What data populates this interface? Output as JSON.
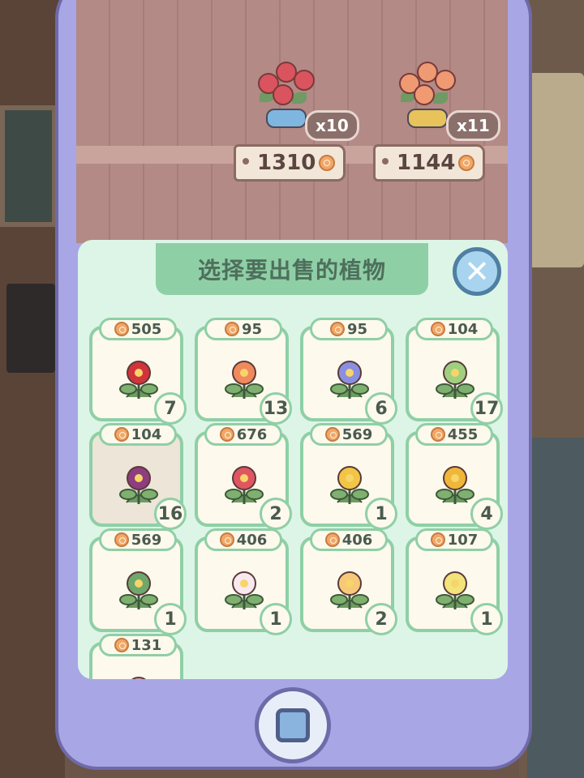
{
  "shelf": {
    "bouquets": [
      {
        "quantity": "x10",
        "price": "1310",
        "bow_color": "#7fb6e0",
        "flower_color": "#d9545e"
      },
      {
        "quantity": "x11",
        "price": "1144",
        "bow_color": "#e8c25a",
        "flower_color": "#ef9a72"
      }
    ]
  },
  "dialog": {
    "title": "选择要出售的植物",
    "close_icon": "close-icon",
    "plants": [
      {
        "price": "505",
        "count": "7",
        "icon": "red-flower-lilypad-icon",
        "color": "#d2343b"
      },
      {
        "price": "95",
        "count": "13",
        "icon": "orange-lily-icon",
        "color": "#f08a5c"
      },
      {
        "price": "95",
        "count": "6",
        "icon": "blue-iris-icon",
        "color": "#8b8fe0"
      },
      {
        "price": "104",
        "count": "17",
        "icon": "green-rose-icon",
        "color": "#9fd07f"
      },
      {
        "price": "104",
        "count": "16",
        "icon": "purple-peony-icon",
        "color": "#8e3d7e"
      },
      {
        "price": "676",
        "count": "2",
        "icon": "red-tulip-icon",
        "color": "#e05660"
      },
      {
        "price": "569",
        "count": "1",
        "icon": "yellow-daffodil-icon",
        "color": "#f3c544"
      },
      {
        "price": "455",
        "count": "4",
        "icon": "yellow-daffodil-icon",
        "color": "#f0b638"
      },
      {
        "price": "569",
        "count": "1",
        "icon": "caladium-leaf-icon",
        "color": "#6fa86a"
      },
      {
        "price": "406",
        "count": "1",
        "icon": "white-lotus-icon",
        "color": "#f7e9ef"
      },
      {
        "price": "406",
        "count": "2",
        "icon": "yellow-lotus-icon",
        "color": "#f6c878"
      },
      {
        "price": "107",
        "count": "1",
        "icon": "yellow-ivy-icon",
        "color": "#f2e37a"
      },
      {
        "price": "131",
        "count": "",
        "icon": "pink-flower-icon",
        "color": "#f0a2b8"
      }
    ]
  },
  "home_button_icon": "home-square-icon"
}
